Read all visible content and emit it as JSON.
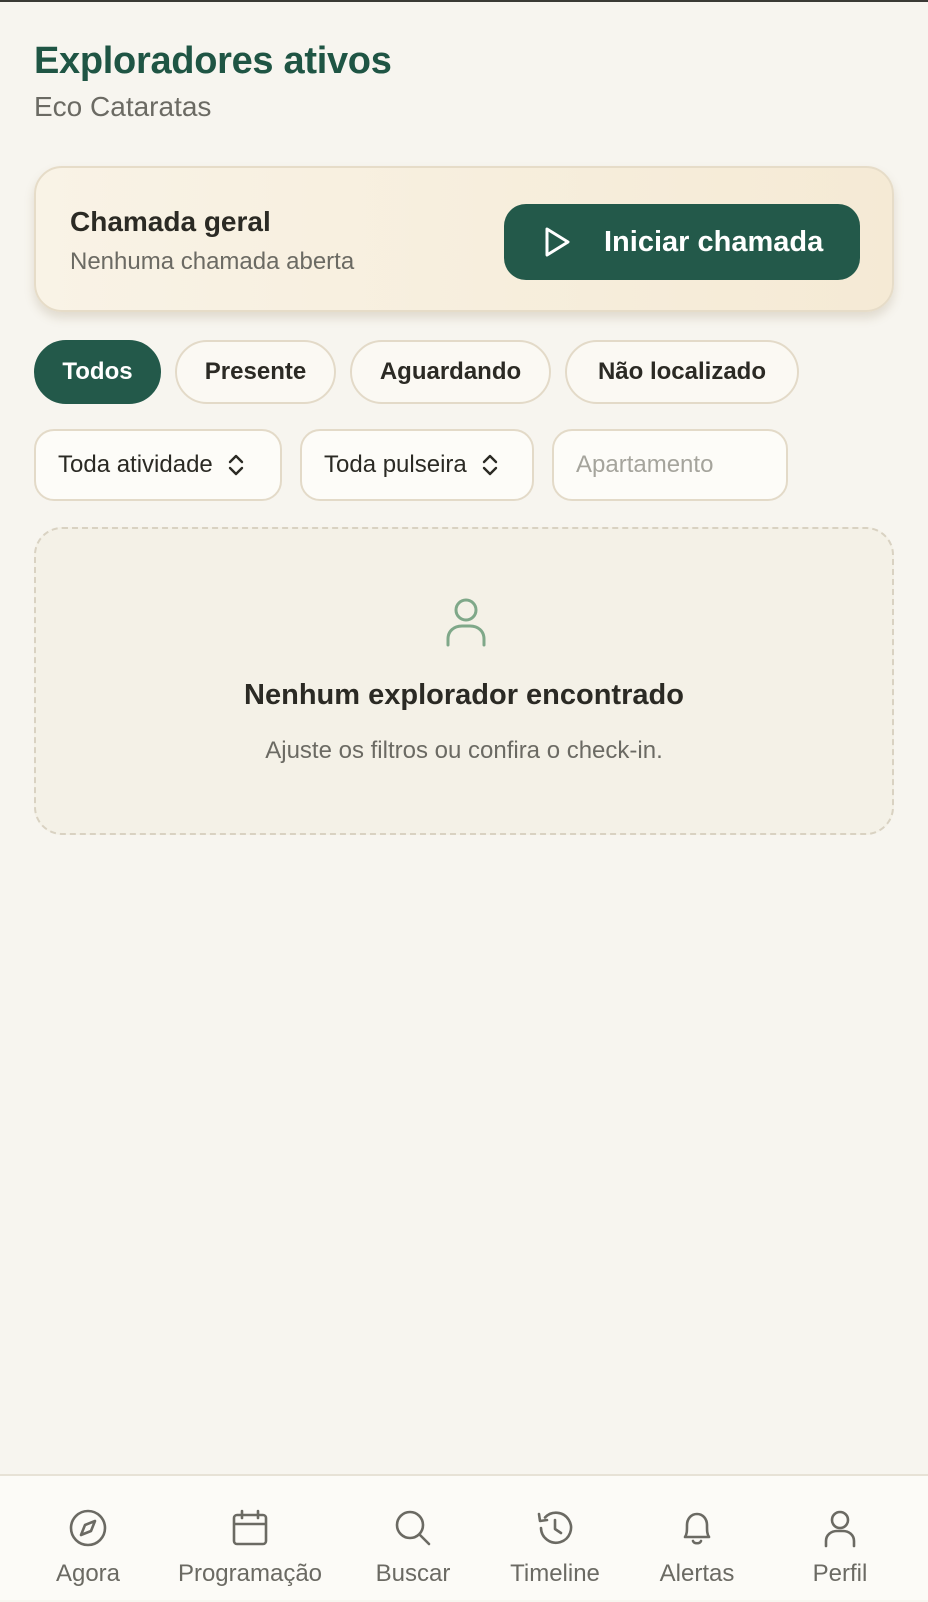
{
  "header": {
    "title": "Exploradores ativos",
    "subtitle": "Eco Cataratas"
  },
  "call_card": {
    "title": "Chamada geral",
    "status": "Nenhuma chamada aberta",
    "button_label": "Iniciar chamada"
  },
  "status_chips": [
    {
      "label": "Todos",
      "active": true
    },
    {
      "label": "Presente",
      "active": false
    },
    {
      "label": "Aguardando",
      "active": false
    },
    {
      "label": "Não localizado",
      "active": false
    }
  ],
  "filters": {
    "activity_select": "Toda atividade",
    "bracelet_select": "Toda pulseira",
    "apartment_placeholder": "Apartamento"
  },
  "empty_state": {
    "icon": "person-icon",
    "title": "Nenhum explorador encontrado",
    "text": "Ajuste os filtros ou confira o check-in."
  },
  "bottom_nav": [
    {
      "label": "Agora",
      "icon": "compass-icon"
    },
    {
      "label": "Programação",
      "icon": "calendar-icon"
    },
    {
      "label": "Buscar",
      "icon": "search-icon"
    },
    {
      "label": "Timeline",
      "icon": "history-icon"
    },
    {
      "label": "Alertas",
      "icon": "bell-icon"
    },
    {
      "label": "Perfil",
      "icon": "user-icon"
    }
  ],
  "colors": {
    "brand": "#23594a",
    "title": "#1f5544",
    "background": "#f7f5ef",
    "muted_text": "#6b6a63",
    "border": "#e3dac8"
  }
}
